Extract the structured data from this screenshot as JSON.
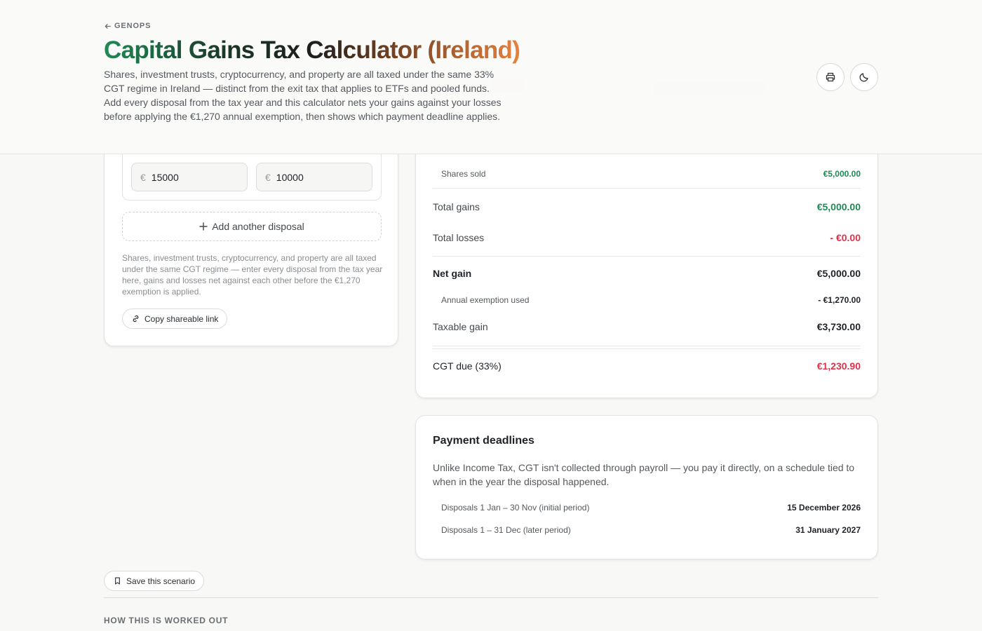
{
  "header": {
    "back_label": "GENOPS",
    "title": "Capital Gains Tax Calculator (Ireland)",
    "subtitle": "Shares, investment trusts, cryptocurrency, and property are all taxed under the same 33% CGT regime in Ireland — distinct from the exit tax that applies to ETFs and pooled funds. Add every disposal from the tax year and this calculator nets your gains against your losses before applying the €1,270 annual exemption, then shows which payment deadline applies.",
    "print_icon": "printer-icon",
    "theme_icon": "moon-icon"
  },
  "disposal": {
    "currency_symbol": "€",
    "proceeds_value": "15000",
    "cost_value": "10000"
  },
  "left": {
    "add_label": "Add another disposal",
    "note": "Shares, investment trusts, cryptocurrency, and property are all taxed under the same CGT regime — enter every disposal from the tax year here, gains and losses net against each other before the €1,270 exemption is applied.",
    "share_label": "Copy shareable link"
  },
  "results": {
    "shares_sold_label": "Shares sold",
    "shares_sold_value": "€5,000.00",
    "total_gains_label": "Total gains",
    "total_gains_value": "€5,000.00",
    "total_losses_label": "Total losses",
    "total_losses_value": "- €0.00",
    "net_gain_label": "Net gain",
    "net_gain_value": "€5,000.00",
    "exemption_label": "Annual exemption used",
    "exemption_value": "- €1,270.00",
    "taxable_label": "Taxable gain",
    "taxable_value": "€3,730.00",
    "cgt_label": "CGT due (33%)",
    "cgt_value": "€1,230.90"
  },
  "deadlines": {
    "title": "Payment deadlines",
    "description": "Unlike Income Tax, CGT isn't collected through payroll — you pay it directly, on a schedule tied to when in the year the disposal happened.",
    "rows": [
      {
        "label": "Disposals 1 Jan – 30 Nov (initial period)",
        "date": "15 December 2026"
      },
      {
        "label": "Disposals 1 – 31 Dec (later period)",
        "date": "31 January 2027"
      }
    ]
  },
  "save_label": "Save this scenario",
  "section_heading": "HOW THIS IS WORKED OUT",
  "colors": {
    "gain": "#1f8a55",
    "loss": "#e0324a"
  }
}
